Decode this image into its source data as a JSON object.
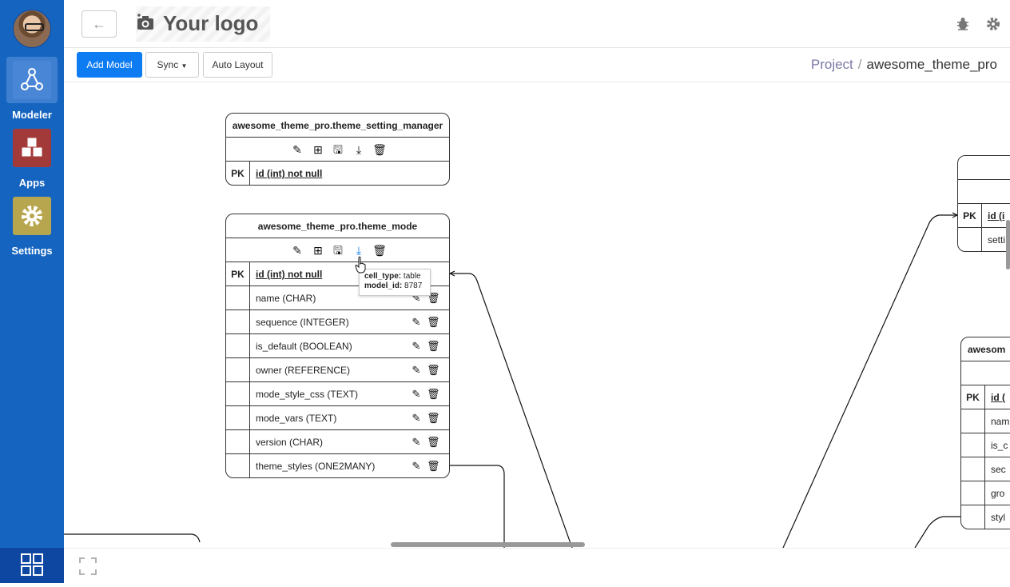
{
  "sidebar": {
    "items": [
      {
        "label": "Modeler",
        "icon": "modeler-icon"
      },
      {
        "label": "Apps",
        "icon": "cubes-icon"
      },
      {
        "label": "Settings",
        "icon": "gear-icon"
      }
    ],
    "bottom_icon": "grid-icon"
  },
  "header": {
    "logo_text": "Your logo",
    "back_icon": "←"
  },
  "toolbar": {
    "add_model": "Add Model",
    "sync": "Sync",
    "auto_layout": "Auto Layout"
  },
  "breadcrumb": {
    "project": "Project",
    "separator": "/",
    "current": "awesome_theme_pro"
  },
  "tables": {
    "setting_manager": {
      "title": "awesome_theme_pro.theme_setting_manager",
      "pk_label": "PK",
      "pk_field": "id (int) not null"
    },
    "theme_mode": {
      "title": "awesome_theme_pro.theme_mode",
      "pk_label": "PK",
      "pk_field": "id (int) not null",
      "fields": [
        "name (CHAR)",
        "sequence (INTEGER)",
        "is_default (BOOLEAN)",
        "owner (REFERENCE)",
        "mode_style_css (TEXT)",
        "mode_vars (TEXT)",
        "version (CHAR)",
        "theme_styles (ONE2MANY)"
      ]
    },
    "right_top": {
      "pk_label": "PK",
      "pk_field": "id (i",
      "row1": "setti"
    },
    "right_bottom": {
      "title": "awesom",
      "pk_label": "PK",
      "pk_field": "id (",
      "rows": [
        "nam",
        "is_c",
        "sec",
        "gro",
        "styl"
      ]
    }
  },
  "tooltip": {
    "k1": "cell_type:",
    "v1": "table",
    "k2": "model_id:",
    "v2": "8787"
  },
  "colors": {
    "sidebar": "#1565c0",
    "primary": "#0d7bf2",
    "apps_tile": "#a33a3a",
    "settings_tile": "#b7a64e"
  }
}
